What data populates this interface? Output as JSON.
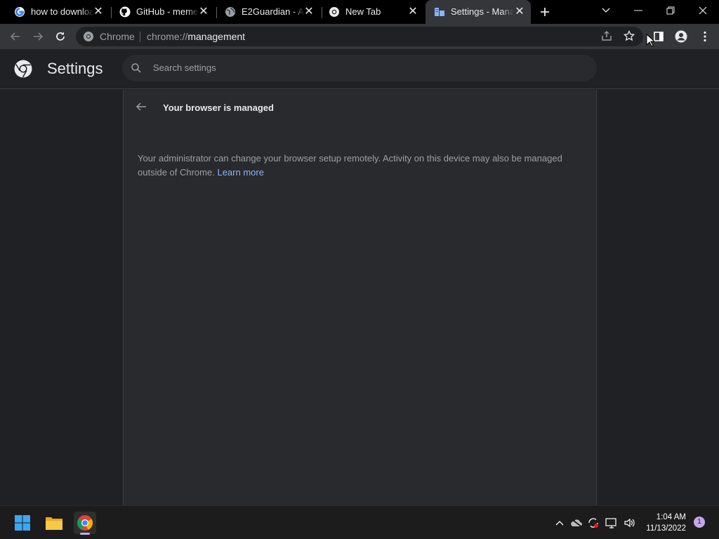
{
  "tabs": [
    {
      "title": "how to download",
      "icon": "google-g-icon"
    },
    {
      "title": "GitHub - meme",
      "icon": "github-icon"
    },
    {
      "title": "E2Guardian - Ac",
      "icon": "globe-icon"
    },
    {
      "title": "New Tab",
      "icon": "chrome-icon"
    },
    {
      "title": "Settings - Mana",
      "icon": "settings-building-icon",
      "active": true
    }
  ],
  "omnibox": {
    "site_label": "Chrome",
    "url_scheme": "chrome://",
    "url_host": "management"
  },
  "settings": {
    "title": "Settings",
    "search_placeholder": "Search settings"
  },
  "management": {
    "heading": "Your browser is managed",
    "description": "Your administrator can change your browser setup remotely. Activity on this device may also be managed outside of Chrome.",
    "learn_more": "Learn more"
  },
  "taskbar": {
    "time": "1:04 AM",
    "date": "11/13/2022",
    "notification_count": "1"
  },
  "colors": {
    "accent": "#8ab4f8",
    "background": "#202124",
    "card": "#292a2d"
  }
}
